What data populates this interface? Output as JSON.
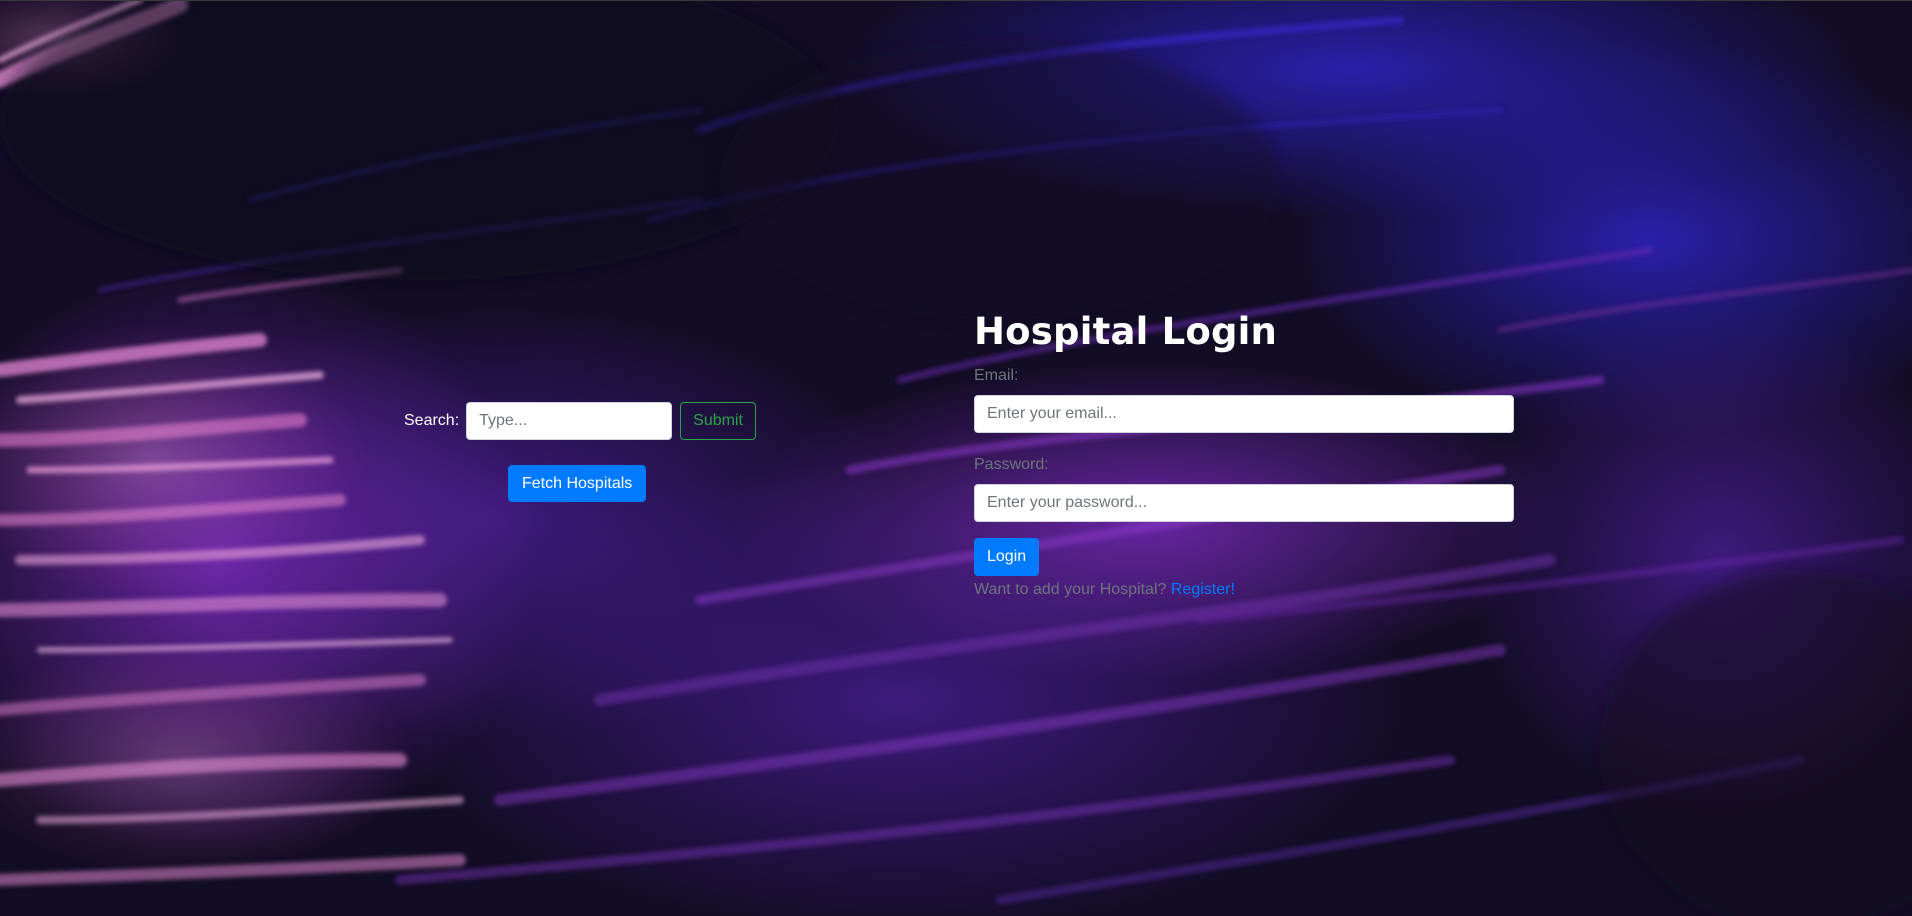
{
  "background": {
    "base_color": "#120c24",
    "accent_pink": "#e68ad6",
    "accent_blue": "#2a1ca8",
    "accent_purple": "#7a2bb8"
  },
  "search": {
    "label": "Search:",
    "value": "",
    "placeholder": "Type...",
    "submit_label": "Submit",
    "fetch_label": "Fetch Hospitals"
  },
  "login": {
    "title": "Hospital Login",
    "email_label": "Email:",
    "email_value": "",
    "email_placeholder": "Enter your email...",
    "password_label": "Password:",
    "password_value": "",
    "password_placeholder": "Enter your password...",
    "submit_label": "Login",
    "register_prompt": "Want to add your Hospital?",
    "register_link": "Register!"
  },
  "colors": {
    "primary": "#007bff",
    "success": "#28a745",
    "muted": "#6c757d"
  }
}
